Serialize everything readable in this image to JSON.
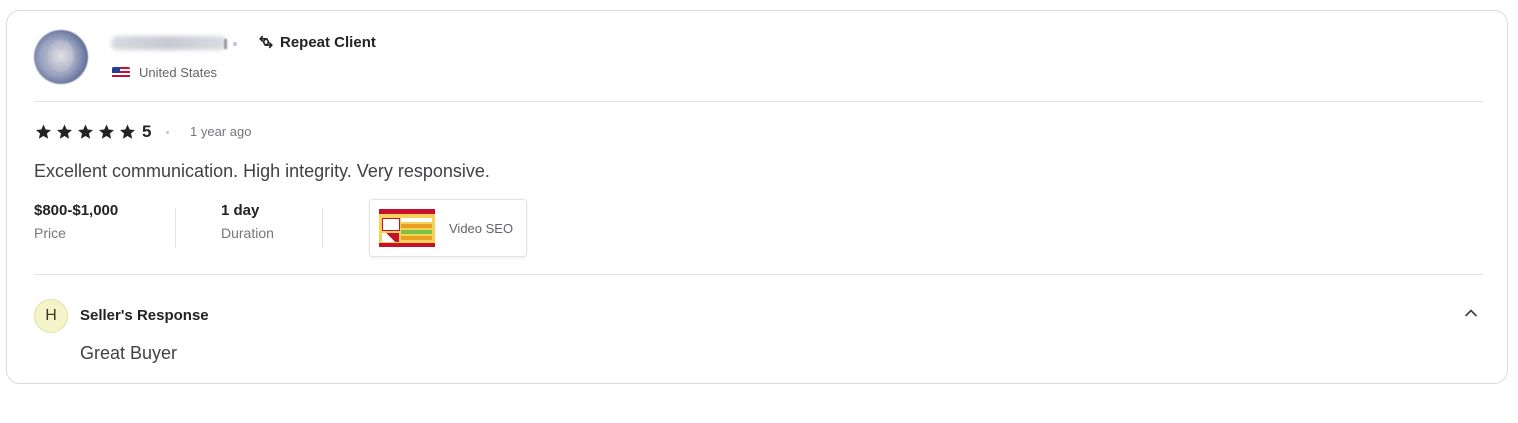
{
  "reviewer": {
    "badge": "Repeat Client",
    "country": "United States",
    "flag_icon": "us-flag-icon"
  },
  "review": {
    "stars": 5,
    "rating": "5",
    "time_ago": "1 year ago",
    "text": "Excellent communication. High integrity. Very responsive.",
    "price_value": "$800-$1,000",
    "price_label": "Price",
    "duration_value": "1 day",
    "duration_label": "Duration",
    "gig_title": "Video SEO"
  },
  "seller_response": {
    "avatar_letter": "H",
    "title": "Seller's Response",
    "text": "Great Buyer",
    "toggle_icon": "chevron-up-icon"
  },
  "colors": {
    "border": "#dadbdd",
    "text_primary": "#222325",
    "text_secondary": "#74767e",
    "seller_avatar_bg": "#f4f4c8"
  }
}
